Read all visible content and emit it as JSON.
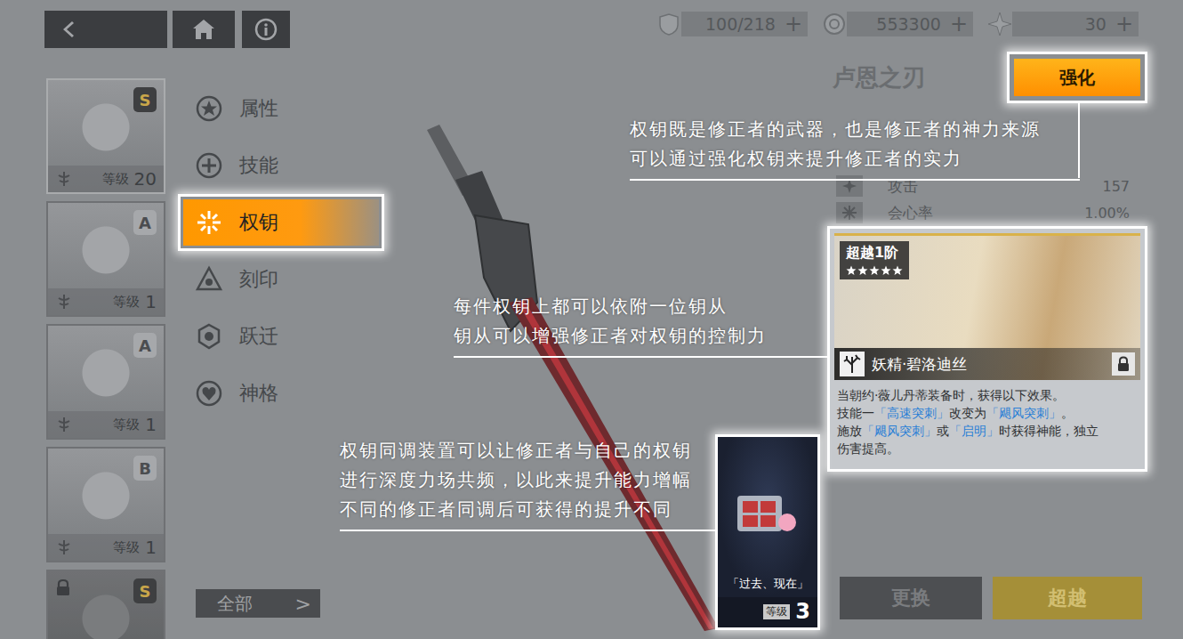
{
  "top_bar": {
    "resources": [
      {
        "value": "100/218",
        "add": "+"
      },
      {
        "value": "553300",
        "add": "+"
      },
      {
        "value": "30",
        "add": "+"
      }
    ]
  },
  "characters": [
    {
      "rank": "S",
      "level_label": "等级",
      "level": "20",
      "locked": false,
      "selected": true
    },
    {
      "rank": "A",
      "level_label": "等级",
      "level": "1",
      "locked": false,
      "selected": false
    },
    {
      "rank": "A",
      "level_label": "等级",
      "level": "1",
      "locked": false,
      "selected": false
    },
    {
      "rank": "B",
      "level_label": "等级",
      "level": "1",
      "locked": false,
      "selected": false
    },
    {
      "rank": "S",
      "locked": true,
      "selected": false
    }
  ],
  "menu": [
    {
      "label": "属性",
      "selected": false
    },
    {
      "label": "技能",
      "selected": false
    },
    {
      "label": "权钥",
      "selected": true
    },
    {
      "label": "刻印",
      "selected": false
    },
    {
      "label": "跃迁",
      "selected": false
    },
    {
      "label": "神格",
      "selected": false
    }
  ],
  "filter_button": {
    "label": "全部",
    "arrow": ">"
  },
  "weapon": {
    "name": "卢恩之刃",
    "stats": [
      {
        "label": "攻击",
        "value": "157"
      },
      {
        "label": "会心率",
        "value": "1.00%"
      }
    ]
  },
  "enhance_button": {
    "label": "强化",
    "highlighted": true
  },
  "attendant_card": {
    "tier": "超越1阶",
    "stars": 5,
    "name": "妖精·碧洛迪丝",
    "locked": true,
    "highlighted": true,
    "description": [
      [
        {
          "text": "当朝约·薇儿丹蒂装备时，获得以下效果。",
          "highlight": false
        }
      ],
      [
        {
          "text": "技能一",
          "highlight": false
        },
        {
          "text": "「高速突刺」",
          "highlight": true
        },
        {
          "text": "改变为",
          "highlight": false
        },
        {
          "text": "「飓风突刺」",
          "highlight": true
        },
        {
          "text": "。",
          "highlight": false
        }
      ],
      [
        {
          "text": "施放",
          "highlight": false
        },
        {
          "text": "「飓风突刺」",
          "highlight": true
        },
        {
          "text": "或",
          "highlight": false
        },
        {
          "text": "「启明」",
          "highlight": true
        },
        {
          "text": "时获得神能，独立伤害提高。",
          "highlight": false
        }
      ]
    ]
  },
  "sync_card": {
    "title": "「过去、现在」",
    "level_label": "等级",
    "level": "3",
    "highlighted": true
  },
  "action_buttons": [
    {
      "label": "更换",
      "kind": "secondary"
    },
    {
      "label": "超越",
      "kind": "primary"
    }
  ],
  "callouts": [
    {
      "lines": [
        "权钥既是修正者的武器，也是修正者的神力来源",
        "可以通过强化权钥来提升修正者的实力"
      ]
    },
    {
      "lines": [
        "每件权钥上都可以依附一位钥从",
        "钥从可以增强修正者对权钥的控制力"
      ]
    },
    {
      "lines": [
        "权钥同调装置可以让修正者与自己的权钥",
        "进行深度力场共频，以此来提升能力增幅",
        "不同的修正者同调后可获得的提升不同"
      ]
    }
  ]
}
